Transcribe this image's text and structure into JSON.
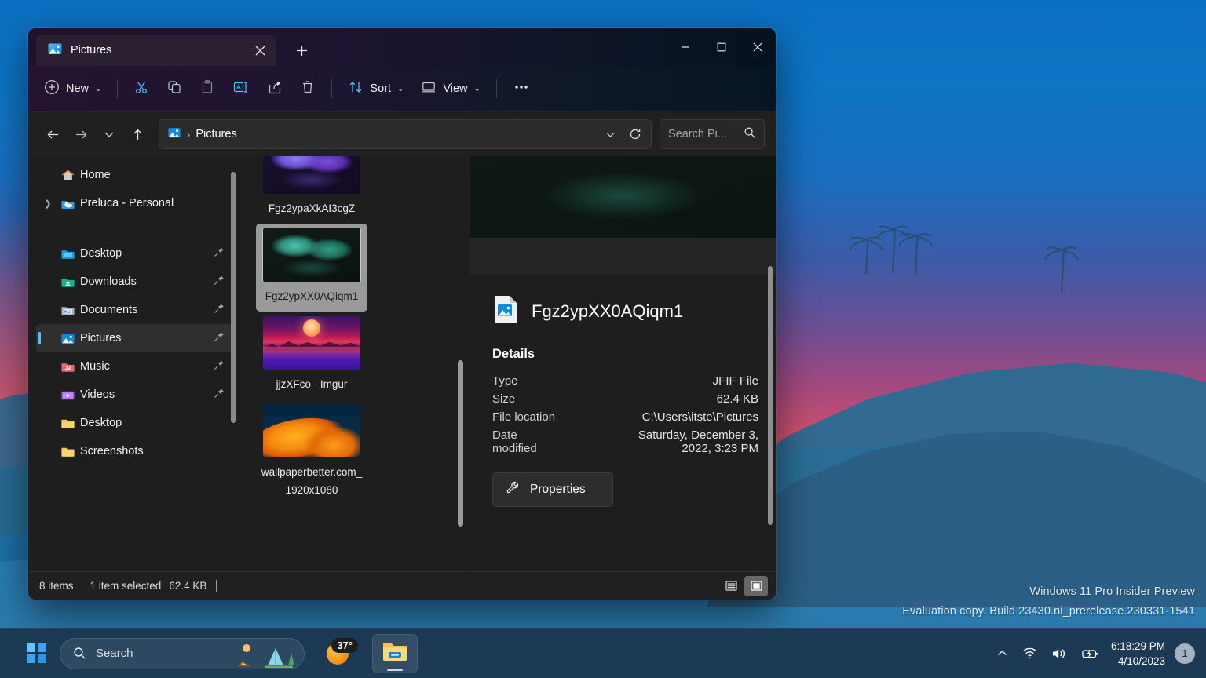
{
  "desktop": {
    "watermark_line1": "Windows 11 Pro Insider Preview",
    "watermark_line2": "Evaluation copy. Build 23430.ni_prerelease.230331-1541"
  },
  "taskbar": {
    "start_label": "Start",
    "search_placeholder": "Search",
    "weather_temp": "37°",
    "explorer_app_label": "File Explorer",
    "time": "6:18:29 PM",
    "date": "4/10/2023",
    "notification_count": "1",
    "tray": {
      "chevron_label": "Show hidden icons",
      "wifi_label": "Network",
      "volume_label": "Volume",
      "battery_label": "Battery"
    }
  },
  "window": {
    "tab_title": "Pictures",
    "newtab_label": "+",
    "minimize_label": "Minimize",
    "maximize_label": "Maximize",
    "close_label": "Close"
  },
  "toolbar": {
    "new_label": "New",
    "cut_label": "Cut",
    "copy_label": "Copy",
    "paste_label": "Paste",
    "rename_label": "Rename",
    "share_label": "Share",
    "delete_label": "Delete",
    "sort_label": "Sort",
    "view_label": "View",
    "more_label": "..."
  },
  "address": {
    "back_label": "Back",
    "forward_label": "Forward",
    "recent_label": "Recent locations",
    "up_label": "Up",
    "breadcrumb": "Pictures",
    "search_placeholder": "Search Pi...",
    "refresh_label": "Refresh"
  },
  "sidebar": {
    "items": [
      {
        "label": "Home",
        "icon": "home-icon",
        "pinned": false,
        "expander": false,
        "selected": false
      },
      {
        "label": "Preluca - Personal",
        "icon": "onedrive-icon",
        "pinned": false,
        "expander": true,
        "selected": false
      },
      {
        "label": "Desktop",
        "icon": "desktop-folder-icon",
        "pinned": true,
        "expander": false,
        "selected": false
      },
      {
        "label": "Downloads",
        "icon": "downloads-folder-icon",
        "pinned": true,
        "expander": false,
        "selected": false
      },
      {
        "label": "Documents",
        "icon": "documents-folder-icon",
        "pinned": true,
        "expander": false,
        "selected": false
      },
      {
        "label": "Pictures",
        "icon": "pictures-folder-icon",
        "pinned": true,
        "expander": false,
        "selected": true
      },
      {
        "label": "Music",
        "icon": "music-folder-icon",
        "pinned": true,
        "expander": false,
        "selected": false
      },
      {
        "label": "Videos",
        "icon": "videos-folder-icon",
        "pinned": true,
        "expander": false,
        "selected": false
      },
      {
        "label": "Desktop",
        "icon": "folder-icon",
        "pinned": false,
        "expander": false,
        "selected": false
      },
      {
        "label": "Screenshots",
        "icon": "folder-icon",
        "pinned": false,
        "expander": false,
        "selected": false
      }
    ]
  },
  "files": [
    {
      "name": "Fgz2ypaXkAI3cgZ",
      "thumb": "bloom-purple",
      "selected": false
    },
    {
      "name": "Fgz2ypXX0AQiqm1",
      "thumb": "bloom-green",
      "selected": true
    },
    {
      "name": "jjzXFco - Imgur",
      "thumb": "synthwave",
      "selected": false
    },
    {
      "name": "wallpaperbetter.com_1920x1080",
      "thumb": "orange-waves",
      "selected": false
    }
  ],
  "details": {
    "filename": "Fgz2ypXX0AQiqm1",
    "section_title": "Details",
    "rows": [
      {
        "key": "Type",
        "value": "JFIF File"
      },
      {
        "key": "Size",
        "value": "62.4 KB"
      },
      {
        "key": "File location",
        "value": "C:\\Users\\itste\\Pictures"
      },
      {
        "key": "Date\nmodified",
        "value": "Saturday, December 3,\n2022, 3:23 PM"
      }
    ],
    "properties_label": "Properties"
  },
  "status": {
    "item_count": "8 items",
    "selection": "1 item selected",
    "selection_size": "62.4 KB",
    "details_view_label": "Details view",
    "large_icons_view_label": "Large icons view"
  },
  "colors": {
    "accent": "#4cc2ff",
    "window_bg": "#1e1e1e",
    "selection_bg": "#9a9a9a",
    "taskbar_bg": "#1a3046"
  }
}
